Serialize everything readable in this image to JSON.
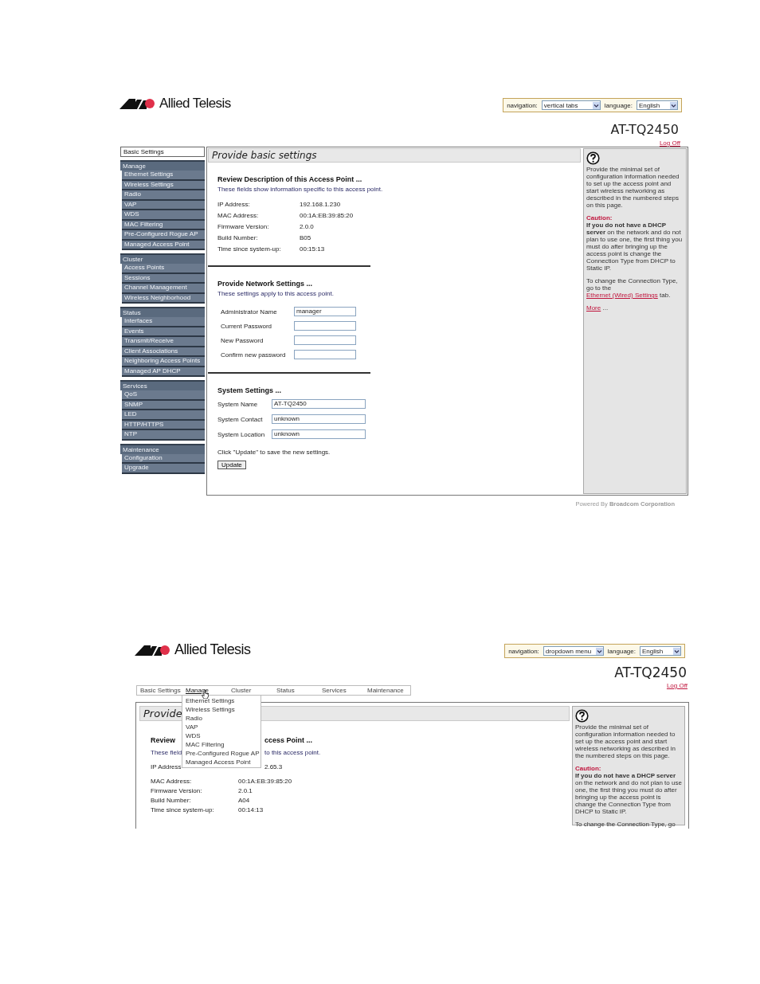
{
  "screens": [
    {
      "kind": "vertical_tabs",
      "brand": "Allied Telesis",
      "preferences": {
        "navigation_label": "navigation:",
        "navigation": "vertical tabs",
        "language_label": "language:",
        "language": "English"
      },
      "model": "AT-TQ2450",
      "log_off": "Log Off",
      "nav": [
        {
          "label": "Basic Settings",
          "selected": true
        },
        {
          "label": "Manage",
          "selected": false,
          "children": [
            {
              "label": "Ethernet Settings",
              "selected": false
            },
            {
              "label": "Wireless Settings",
              "selected": false
            },
            {
              "label": "Radio",
              "selected": false
            },
            {
              "label": "VAP",
              "selected": false
            },
            {
              "label": "WDS",
              "selected": false
            },
            {
              "label": "MAC Filtering",
              "selected": false
            },
            {
              "label": "Pre-Configured Rogue AP",
              "selected": false
            },
            {
              "label": "Managed Access Point",
              "selected": false
            }
          ]
        },
        {
          "label": "Cluster",
          "selected": false,
          "children": [
            {
              "label": "Access Points",
              "selected": false
            },
            {
              "label": "Sessions",
              "selected": false
            },
            {
              "label": "Channel Management",
              "selected": false
            },
            {
              "label": "Wireless Neighborhood",
              "selected": false
            }
          ]
        },
        {
          "label": "Status",
          "selected": false,
          "children": [
            {
              "label": "Interfaces",
              "selected": false
            },
            {
              "label": "Events",
              "selected": false
            },
            {
              "label": "Transmit/Receive",
              "selected": false
            },
            {
              "label": "Client Associations",
              "selected": false
            },
            {
              "label": "Neighboring Access Points",
              "selected": false
            },
            {
              "label": "Managed AP DHCP",
              "selected": false
            }
          ]
        },
        {
          "label": "Services",
          "selected": false,
          "children": [
            {
              "label": "QoS",
              "selected": false
            },
            {
              "label": "SNMP",
              "selected": false
            },
            {
              "label": "LED",
              "selected": false
            },
            {
              "label": "HTTP/HTTPS",
              "selected": false
            },
            {
              "label": "NTP",
              "selected": false
            }
          ]
        },
        {
          "label": "Maintenance",
          "selected": false,
          "children": [
            {
              "label": "Configuration",
              "selected": false
            },
            {
              "label": "Upgrade",
              "selected": false
            }
          ]
        }
      ],
      "title": "Provide basic settings",
      "sections": [
        {
          "heading": "Review Description of this Access Point ...",
          "note": "These fields show information specific to this access point.",
          "rows": [
            {
              "kind": "text",
              "label": "IP Address:",
              "value": "192.168.1.230"
            },
            {
              "kind": "text",
              "label": "MAC Address:",
              "value": "00:1A:EB:39:85:20"
            },
            {
              "kind": "text",
              "label": "Firmware Version:",
              "value": "2.0.0"
            },
            {
              "kind": "text",
              "label": "Build Number:",
              "value": "B05"
            },
            {
              "kind": "text",
              "label": "Time since system-up:",
              "value": "00:15:13"
            }
          ]
        },
        {
          "heading": "Provide Network Settings ...",
          "note": "These settings apply to this access point.",
          "rows": [
            {
              "kind": "input",
              "label": "Administrator Name",
              "value": "manager"
            },
            {
              "kind": "input",
              "label": "Current Password"
            },
            {
              "kind": "input",
              "label": "New Password"
            },
            {
              "kind": "input",
              "label": "Confirm new password"
            }
          ]
        },
        {
          "heading": "System Settings ...",
          "rows": [
            {
              "kind": "wide_input",
              "label": "System Name",
              "value": "AT-TQ2450"
            },
            {
              "kind": "wide_input",
              "label": "System Contact",
              "value": "unknown"
            },
            {
              "kind": "wide_input",
              "label": "System Location",
              "value": "unknown"
            }
          ],
          "footer_note": "Click \"Update\" to save the new settings.",
          "button": "Update"
        }
      ],
      "help": {
        "intro": "Provide the minimal set of configuration information needed to set up the access point and start wireless networking as described in the numbered steps on this page.",
        "caution_label": "Caution:",
        "caution": "**If you do not have a DHCP server** on the network and do not plan to use one, the first thing you must do after bringing up the access point is change the Connection Type from DHCP to Static IP.",
        "change_text": "To change the Connection Type, go to the",
        "change_link": "Ethernet (Wired) Settings",
        "change_tail": "tab.",
        "more_link": "More",
        "more_tail": "..."
      },
      "footer": "Powered By **Broadcom Corporation**"
    },
    {
      "kind": "dropdown_menu",
      "brand": "Allied Telesis",
      "preferences": {
        "navigation_label": "navigation:",
        "navigation": "dropdown menu",
        "language_label": "language:",
        "language": "English"
      },
      "model": "AT-TQ2450",
      "log_off": "Log Off",
      "nav": [
        {
          "label": "Basic Settings",
          "selected": false,
          "expanded": false
        },
        {
          "label": "Manage",
          "selected": false,
          "expanded": true,
          "children": [
            {
              "label": "Ethernet Settings",
              "selected": false
            },
            {
              "label": "Wireless Settings",
              "selected": false
            },
            {
              "label": "Radio",
              "selected": false
            },
            {
              "label": "VAP",
              "selected": false
            },
            {
              "label": "WDS",
              "selected": false
            },
            {
              "label": "MAC Filtering",
              "selected": false
            },
            {
              "label": "Pre-Configured Rogue AP",
              "selected": false
            },
            {
              "label": "Managed Access Point",
              "selected": false
            }
          ]
        },
        {
          "label": "Cluster",
          "selected": false,
          "expanded": false
        },
        {
          "label": "Status",
          "selected": false,
          "expanded": false
        },
        {
          "label": "Services",
          "selected": false,
          "expanded": false
        },
        {
          "label": "Maintenance",
          "selected": false,
          "expanded": false
        }
      ],
      "title": "Provide",
      "sections": [
        {
          "heading_parts": [
            "Review",
            "ccess Point ..."
          ],
          "note_parts": [
            "These field",
            "to this access point."
          ],
          "rows": [
            {
              "kind": "covered_text",
              "label": "IP Address",
              "value": "2.65.3"
            },
            {
              "kind": "text",
              "label": "MAC Address:",
              "value": "00:1A:EB:39:85:20"
            },
            {
              "kind": "text",
              "label": "Firmware Version:",
              "value": "2.0.1"
            },
            {
              "kind": "text",
              "label": "Build Number:",
              "value": "A04"
            },
            {
              "kind": "text",
              "label": "Time since system-up:",
              "value": "00:14:13"
            }
          ]
        }
      ],
      "help": {
        "intro": "Provide the minimal set of configuration information needed to set up the access point and start wireless networking as described in the numbered steps on this page.",
        "caution_label": "Caution:",
        "caution": "**If you do not have a DHCP server** on the network and do not plan to use one, the first thing you must do after bringing up the access point is change the Connection Type from DHCP to Static IP.",
        "change_text": "To change the Connection Type, go"
      }
    }
  ]
}
